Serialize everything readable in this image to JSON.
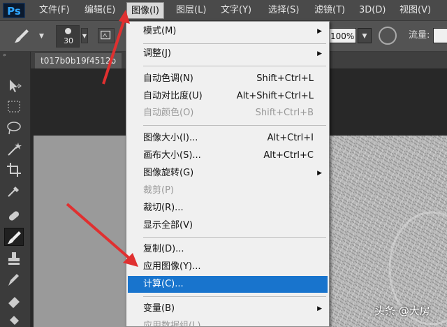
{
  "app": {
    "logo": "Ps"
  },
  "menubar": {
    "items": [
      "文件(F)",
      "编辑(E)",
      "图像(I)",
      "图层(L)",
      "文字(Y)",
      "选择(S)",
      "滤镜(T)",
      "3D(D)",
      "视图(V)"
    ],
    "active_index": 2
  },
  "options": {
    "brush_size": "30",
    "opacity_value": "100%",
    "flow_label": "流量:"
  },
  "document": {
    "tab_title": "t017b0b19f4512b"
  },
  "image_menu": {
    "items": [
      {
        "label": "模式(M)",
        "shortcut": "",
        "submenu": true,
        "enabled": true
      },
      {
        "label": "调整(J)",
        "shortcut": "",
        "submenu": true,
        "enabled": true
      },
      {
        "label": "自动色调(N)",
        "shortcut": "Shift+Ctrl+L",
        "submenu": false,
        "enabled": true
      },
      {
        "label": "自动对比度(U)",
        "shortcut": "Alt+Shift+Ctrl+L",
        "submenu": false,
        "enabled": true
      },
      {
        "label": "自动颜色(O)",
        "shortcut": "Shift+Ctrl+B",
        "submenu": false,
        "enabled": false
      },
      {
        "label": "图像大小(I)...",
        "shortcut": "Alt+Ctrl+I",
        "submenu": false,
        "enabled": true
      },
      {
        "label": "画布大小(S)...",
        "shortcut": "Alt+Ctrl+C",
        "submenu": false,
        "enabled": true
      },
      {
        "label": "图像旋转(G)",
        "shortcut": "",
        "submenu": true,
        "enabled": true
      },
      {
        "label": "裁剪(P)",
        "shortcut": "",
        "submenu": false,
        "enabled": false
      },
      {
        "label": "裁切(R)...",
        "shortcut": "",
        "submenu": false,
        "enabled": true
      },
      {
        "label": "显示全部(V)",
        "shortcut": "",
        "submenu": false,
        "enabled": true
      },
      {
        "label": "复制(D)...",
        "shortcut": "",
        "submenu": false,
        "enabled": true
      },
      {
        "label": "应用图像(Y)...",
        "shortcut": "",
        "submenu": false,
        "enabled": true
      },
      {
        "label": "计算(C)...",
        "shortcut": "",
        "submenu": false,
        "enabled": true,
        "highlighted": true
      },
      {
        "label": "变量(B)",
        "shortcut": "",
        "submenu": true,
        "enabled": true
      },
      {
        "label": "应用数据组(L)...",
        "shortcut": "",
        "submenu": false,
        "enabled": false
      }
    ]
  },
  "watermark": "头条 @大房",
  "colors": {
    "highlight": "#1874cd",
    "arrow": "#e03030"
  },
  "icons": [
    "brush-icon",
    "move-icon",
    "marquee-icon",
    "lasso-icon",
    "magic-wand-icon",
    "crop-icon",
    "eyedropper-icon",
    "healing-brush-icon",
    "brush-tool-icon",
    "clone-stamp-icon",
    "history-brush-icon",
    "eraser-icon",
    "airbrush-icon",
    "submenu-arrow-icon"
  ]
}
